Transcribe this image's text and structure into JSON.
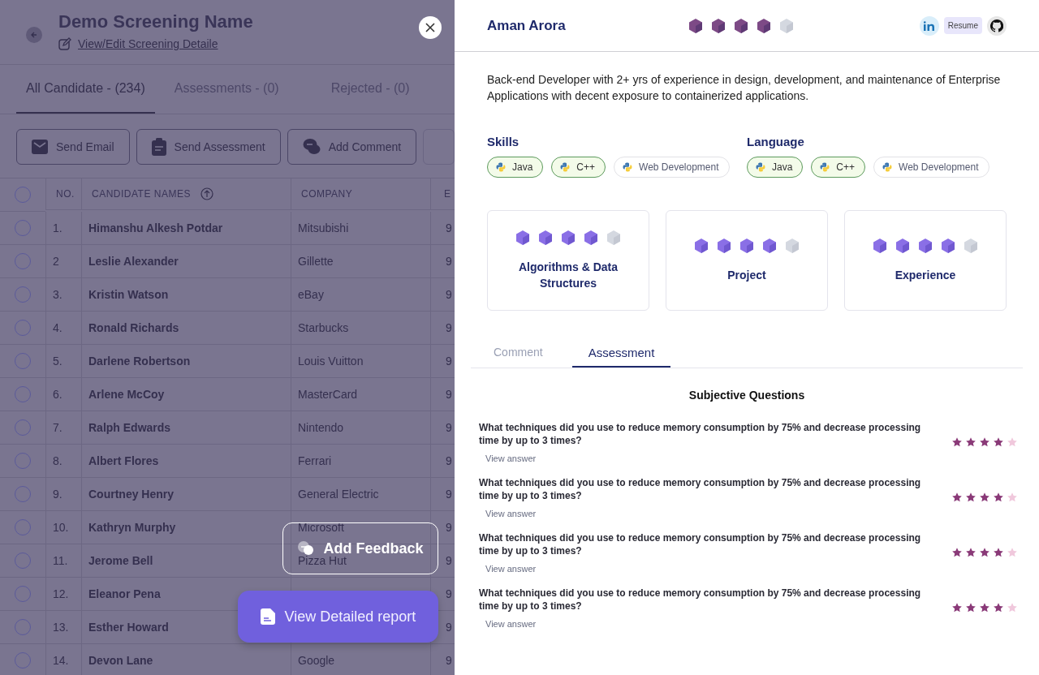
{
  "screening": {
    "title": "Demo Screening Name",
    "edit_link": "View/Edit Screening Detaile"
  },
  "tabs": [
    {
      "label": "All Candidate - (234)",
      "selected": true
    },
    {
      "label": "Assessments - (0)",
      "selected": false
    },
    {
      "label": "Rejected - (0)",
      "selected": false
    }
  ],
  "actions": [
    {
      "kind": "mail",
      "label": "Send Email"
    },
    {
      "kind": "clipboard",
      "label": "Send Assessment"
    },
    {
      "kind": "comment",
      "label": "Add Comment"
    },
    {
      "kind": "cut"
    }
  ],
  "table": {
    "all_selected": false,
    "columns": [
      "NO.",
      "CANDIDATE NAMES",
      "COMPANY",
      "E"
    ],
    "rows": [
      {
        "no": "1.",
        "name": "Himanshu Alkesh Potdar",
        "company": "Mitsubishi",
        "column_4": "9",
        "selected": false
      },
      {
        "no": "2",
        "name": "Leslie Alexander",
        "company": "Gillette",
        "column_4": "9",
        "selected": false
      },
      {
        "no": "3.",
        "name": "Kristin Watson",
        "company": "eBay",
        "column_4": "9",
        "selected": false
      },
      {
        "no": "4.",
        "name": "Ronald Richards",
        "company": "Starbucks",
        "column_4": "9",
        "selected": false
      },
      {
        "no": "5.",
        "name": "Darlene Robertson",
        "company": "Louis Vuitton",
        "column_4": "9",
        "selected": false
      },
      {
        "no": "6.",
        "name": "Arlene McCoy",
        "company": "MasterCard",
        "column_4": "9",
        "selected": false
      },
      {
        "no": "7.",
        "name": "Ralph Edwards",
        "company": "Nintendo",
        "column_4": "9",
        "selected": false
      },
      {
        "no": "8.",
        "name": "Albert Flores",
        "company": "Ferrari",
        "column_4": "9",
        "selected": false
      },
      {
        "no": "9.",
        "name": "Courtney Henry",
        "company": "General Electric",
        "column_4": "9",
        "selected": false
      },
      {
        "no": "10.",
        "name": "Kathryn Murphy",
        "company": "Microsoft",
        "column_4": "9",
        "selected": false
      },
      {
        "no": "11.",
        "name": "Jerome Bell",
        "company": "Pizza Hut",
        "column_4": "9",
        "selected": false
      },
      {
        "no": "12.",
        "name": "Eleanor Pena",
        "column_4": "9",
        "selected": false
      },
      {
        "no": "13.",
        "name": "Esther Howard",
        "column_4": "9",
        "selected": false
      },
      {
        "no": "14.",
        "name": "Devon Lane",
        "company": "Google",
        "column_4": "9",
        "selected": false
      }
    ]
  },
  "add_feedback": "Add Feedback",
  "report_button": "View Detailed report",
  "profile": {
    "name": "Aman Arora",
    "stars": 4,
    "resume": "Resume",
    "summary": "Back-end Developer with 2+ yrs of experience in design, development, and maintenance of Enterprise Applications with decent exposure to containerized applications.",
    "groups": [
      {
        "title": "Skills",
        "tags": [
          {
            "label": "Java",
            "highlighted": true
          },
          {
            "label": "C++",
            "highlighted": true
          },
          {
            "label": "Web Development",
            "highlighted": false
          }
        ]
      },
      {
        "title": "Language",
        "tags": [
          {
            "label": "Java",
            "highlighted": true
          },
          {
            "label": "C++",
            "highlighted": true
          },
          {
            "label": "Web Development",
            "highlighted": false
          }
        ]
      }
    ],
    "scores": [
      {
        "title": "Algorithms & Data Structures",
        "stars": 4
      },
      {
        "title": "Project",
        "stars": 4
      },
      {
        "title": "Experience",
        "stars": 4
      }
    ],
    "detail_tabs": [
      {
        "label": "Comment",
        "selected": false
      },
      {
        "label": "Assessment",
        "selected": true
      }
    ],
    "section_title": "Subjective Questions",
    "questions": [
      {
        "text": "What techniques did you use to reduce memory consumption by 75% and decrease processing time by up to 3 times?",
        "link": "View answer",
        "stars": 4
      },
      {
        "text": "What techniques did you use to reduce memory consumption by 75% and decrease processing time by up to 3 times?",
        "link": "View answer",
        "stars": 4
      },
      {
        "text": "What techniques did you use to reduce memory consumption by 75% and decrease processing time by up to 3 times?",
        "link": "View answer",
        "stars": 4
      },
      {
        "text": "What techniques did you use to reduce memory consumption by 75% and decrease processing time by up to 3 times?",
        "link": "View answer",
        "stars": 4
      }
    ]
  }
}
